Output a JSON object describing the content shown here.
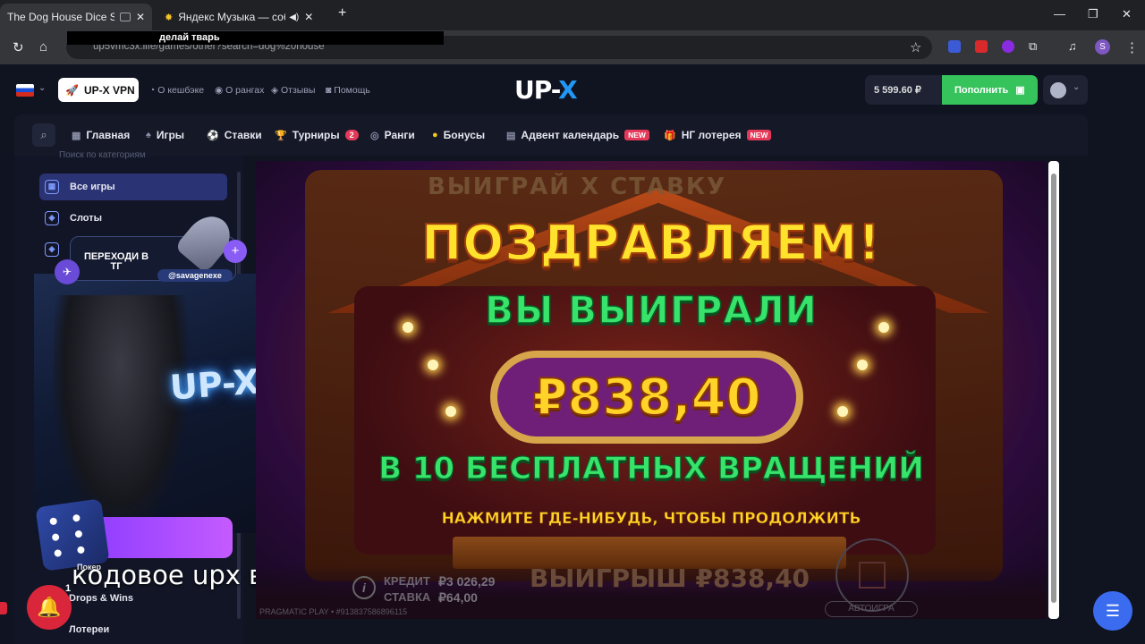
{
  "browser": {
    "tabs": [
      {
        "title": "The Dog House Dice Show"
      },
      {
        "title": "Яндекс Музыка — собирае"
      }
    ],
    "new_tab": "+",
    "window_controls": [
      "—",
      "❐",
      "✕"
    ],
    "url": "up5vmc3x.life/games/other?search=dog%20house",
    "overlay_text": "делай тварь"
  },
  "header": {
    "vpn_label": "UP-X VPN",
    "links": [
      "О кешбэке",
      "О рангах",
      "Отзывы",
      "Помощь"
    ],
    "logo_main": "UP-",
    "logo_accent": "X",
    "balance": "5 599.60 ₽",
    "deposit_label": "Пополнить"
  },
  "nav": {
    "items": [
      {
        "label": "Главная",
        "icon": "grid-icon"
      },
      {
        "label": "Игры",
        "icon": "spade-icon"
      },
      {
        "label": "Ставки",
        "icon": "ball-icon"
      },
      {
        "label": "Турниры",
        "icon": "cup-icon",
        "badge": "2"
      },
      {
        "label": "Ранги",
        "icon": "medal-icon"
      },
      {
        "label": "Бонусы",
        "icon": "coin-icon"
      },
      {
        "label": "Адвент календарь",
        "icon": "calendar-icon",
        "tag": "NEW"
      },
      {
        "label": "НГ лотерея",
        "icon": "gift-icon",
        "tag": "NEW"
      }
    ]
  },
  "sidebar": {
    "search_placeholder": "Поиск по категориям",
    "items": [
      "Все игры",
      "Слоты"
    ],
    "bottom_items": [
      "Покер",
      "Drops & Wins",
      "Лотереи"
    ]
  },
  "overlay": {
    "tg_text": "ПЕРЕХОДИ В ТГ",
    "tg_handle": "@savagenexe",
    "neon_sign": "UP-X",
    "chat_caption": "кодовое upx в чат",
    "notification_count": "1"
  },
  "game": {
    "top_faded": "ВЫИГРАЙ    X СТАВКУ",
    "title": "ПОЗДРАВЛЯЕМ!",
    "won_line": "ВЫ ВЫИГРАЛИ",
    "amount": "₽838,40",
    "spins_line": "В 10 БЕСПЛАТНЫХ ВРАЩЕНИЙ",
    "hint": "НАЖМИТЕ ГДЕ-НИБУДЬ, ЧТОБЫ ПРОДОЛЖИТЬ",
    "credit_label": "КРЕДИТ",
    "credit_value": "₽3 026,29",
    "bet_label": "СТАВКА",
    "bet_value": "₽64,00",
    "win_label": "ВЫИГРЫШ ₽838,40",
    "autoplay_label": "АВТОИГРА",
    "footer": "PRAGMATIC PLAY • #913837586896115"
  }
}
